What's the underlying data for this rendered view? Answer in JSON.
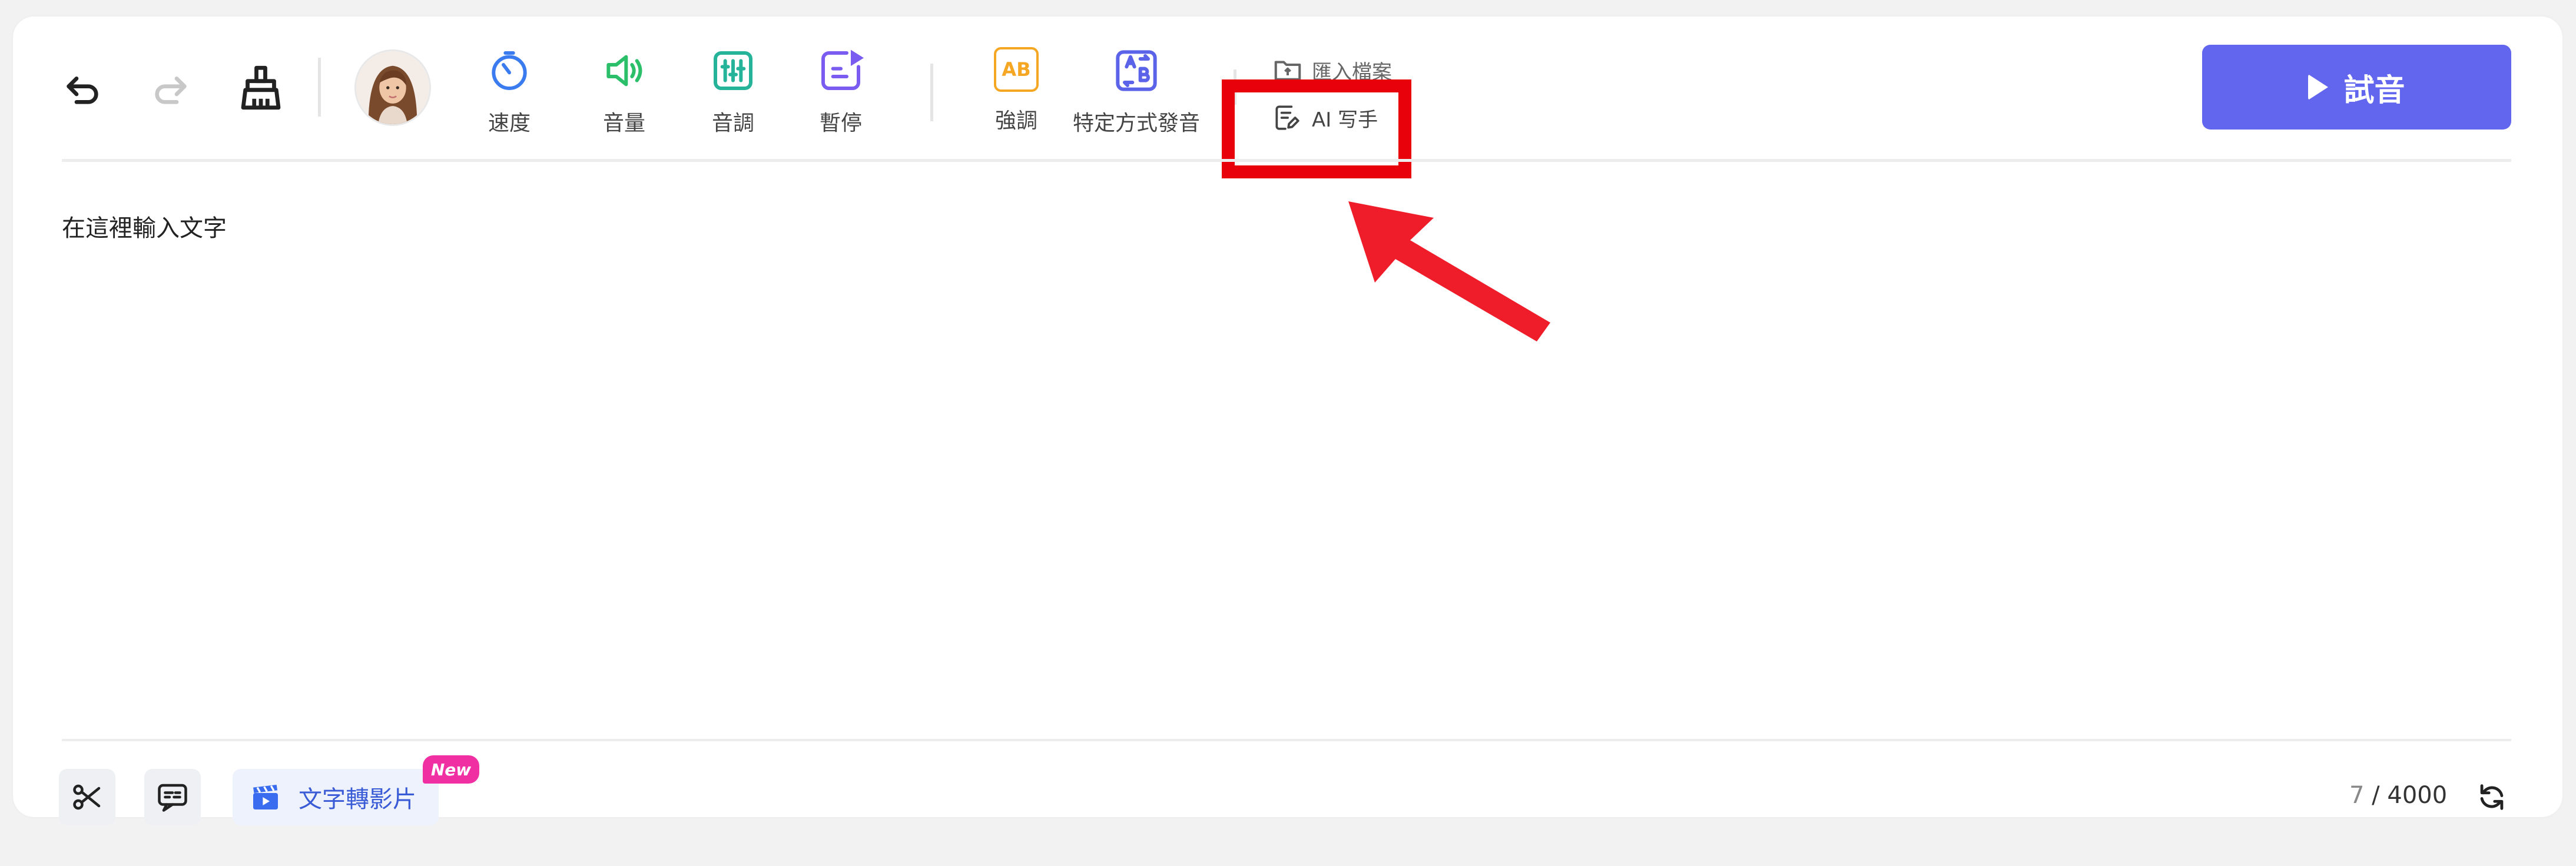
{
  "toolbar": {
    "speed_label": "速度",
    "volume_label": "音量",
    "pitch_label": "音調",
    "pause_label": "暫停",
    "emphasis_label": "強調",
    "pronunciation_label": "特定方式發音",
    "import_label": "匯入檔案",
    "ai_writer_label": "AI 写手",
    "emphasis_icon_text": "AB",
    "play_label": "試音"
  },
  "editor": {
    "placeholder": "在這裡輸入文字"
  },
  "footer": {
    "video_label": "文字轉影片",
    "new_badge": "New",
    "char_count": "7",
    "char_limit": "/ 4000"
  },
  "colors": {
    "accent": "#6266ef",
    "speed": "#3a7bf0",
    "volume": "#2bbf6a",
    "pitch": "#25b39a",
    "pause": "#7b5cf0",
    "emphasis": "#f5a623",
    "pronunciation": "#5b63e8",
    "highlight": "#e8000b"
  }
}
